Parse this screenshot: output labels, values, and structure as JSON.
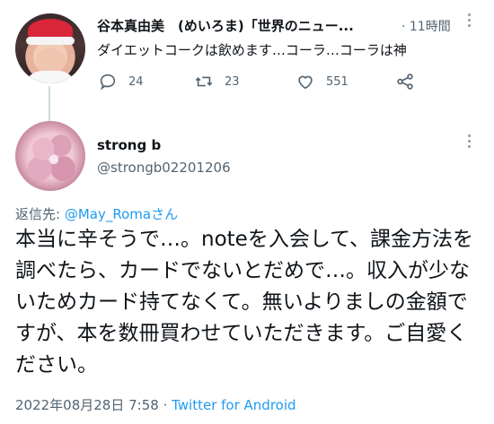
{
  "tweet1": {
    "name": "谷本真由美　(めいろま)「世界のニュー...",
    "time": "· 11時間",
    "text": "ダイエットコークは飲めます…コーラ…コーラは神",
    "replies": "24",
    "retweets": "23",
    "likes": "551"
  },
  "tweet2": {
    "name": "strong b",
    "handle": "@strongb02201206",
    "reply_prefix": "返信先: ",
    "reply_mention": "@May_Romaさん",
    "body": "本当に辛そうで…。noteを入会して、課金方法を調べたら、カードでないとだめで…。収入が少ないためカード持てなくて。無いよりましの金額ですが、本を数冊買わせていただきます。ご自愛ください。",
    "timestamp": "2022年08月28日 7:58 · ",
    "source": "Twitter for Android"
  },
  "icons": {
    "reply": "reply-icon",
    "retweet": "retweet-icon",
    "like": "heart-icon",
    "share": "share-icon",
    "more": "more-icon"
  },
  "colors": {
    "link": "#1d9bf0",
    "secondary": "#536471"
  }
}
